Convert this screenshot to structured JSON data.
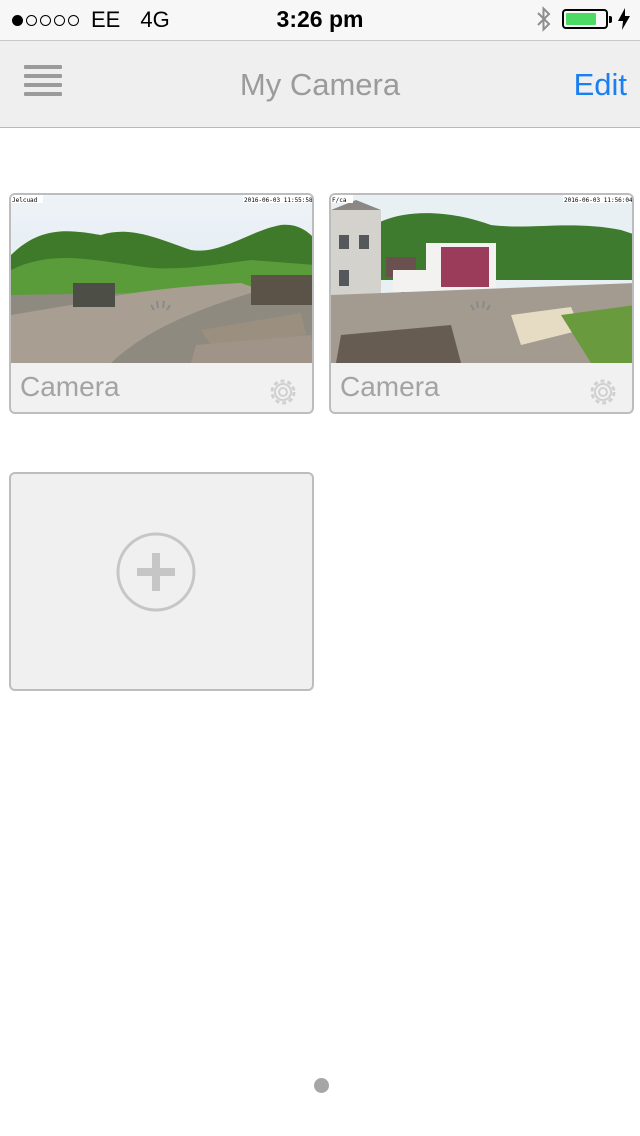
{
  "status_bar": {
    "signal_dots": "●○○○○",
    "carrier": "EE",
    "network": "4G",
    "time": "3:26 pm",
    "battery_color": "#4cd964"
  },
  "nav": {
    "menu_icon": "hamburger-menu-icon",
    "title": "My Camera",
    "edit_label": "Edit",
    "edit_color": "#1a7ff0"
  },
  "cameras": [
    {
      "label": "Camera",
      "overlay_left": "Jelcuad",
      "overlay_right": "2016-06-03 11:55:58"
    },
    {
      "label": "Camera",
      "overlay_left": "F/ca",
      "overlay_right": "2016-06-03 11:56:04"
    }
  ],
  "add_camera": {
    "icon": "plus-circle-icon"
  }
}
